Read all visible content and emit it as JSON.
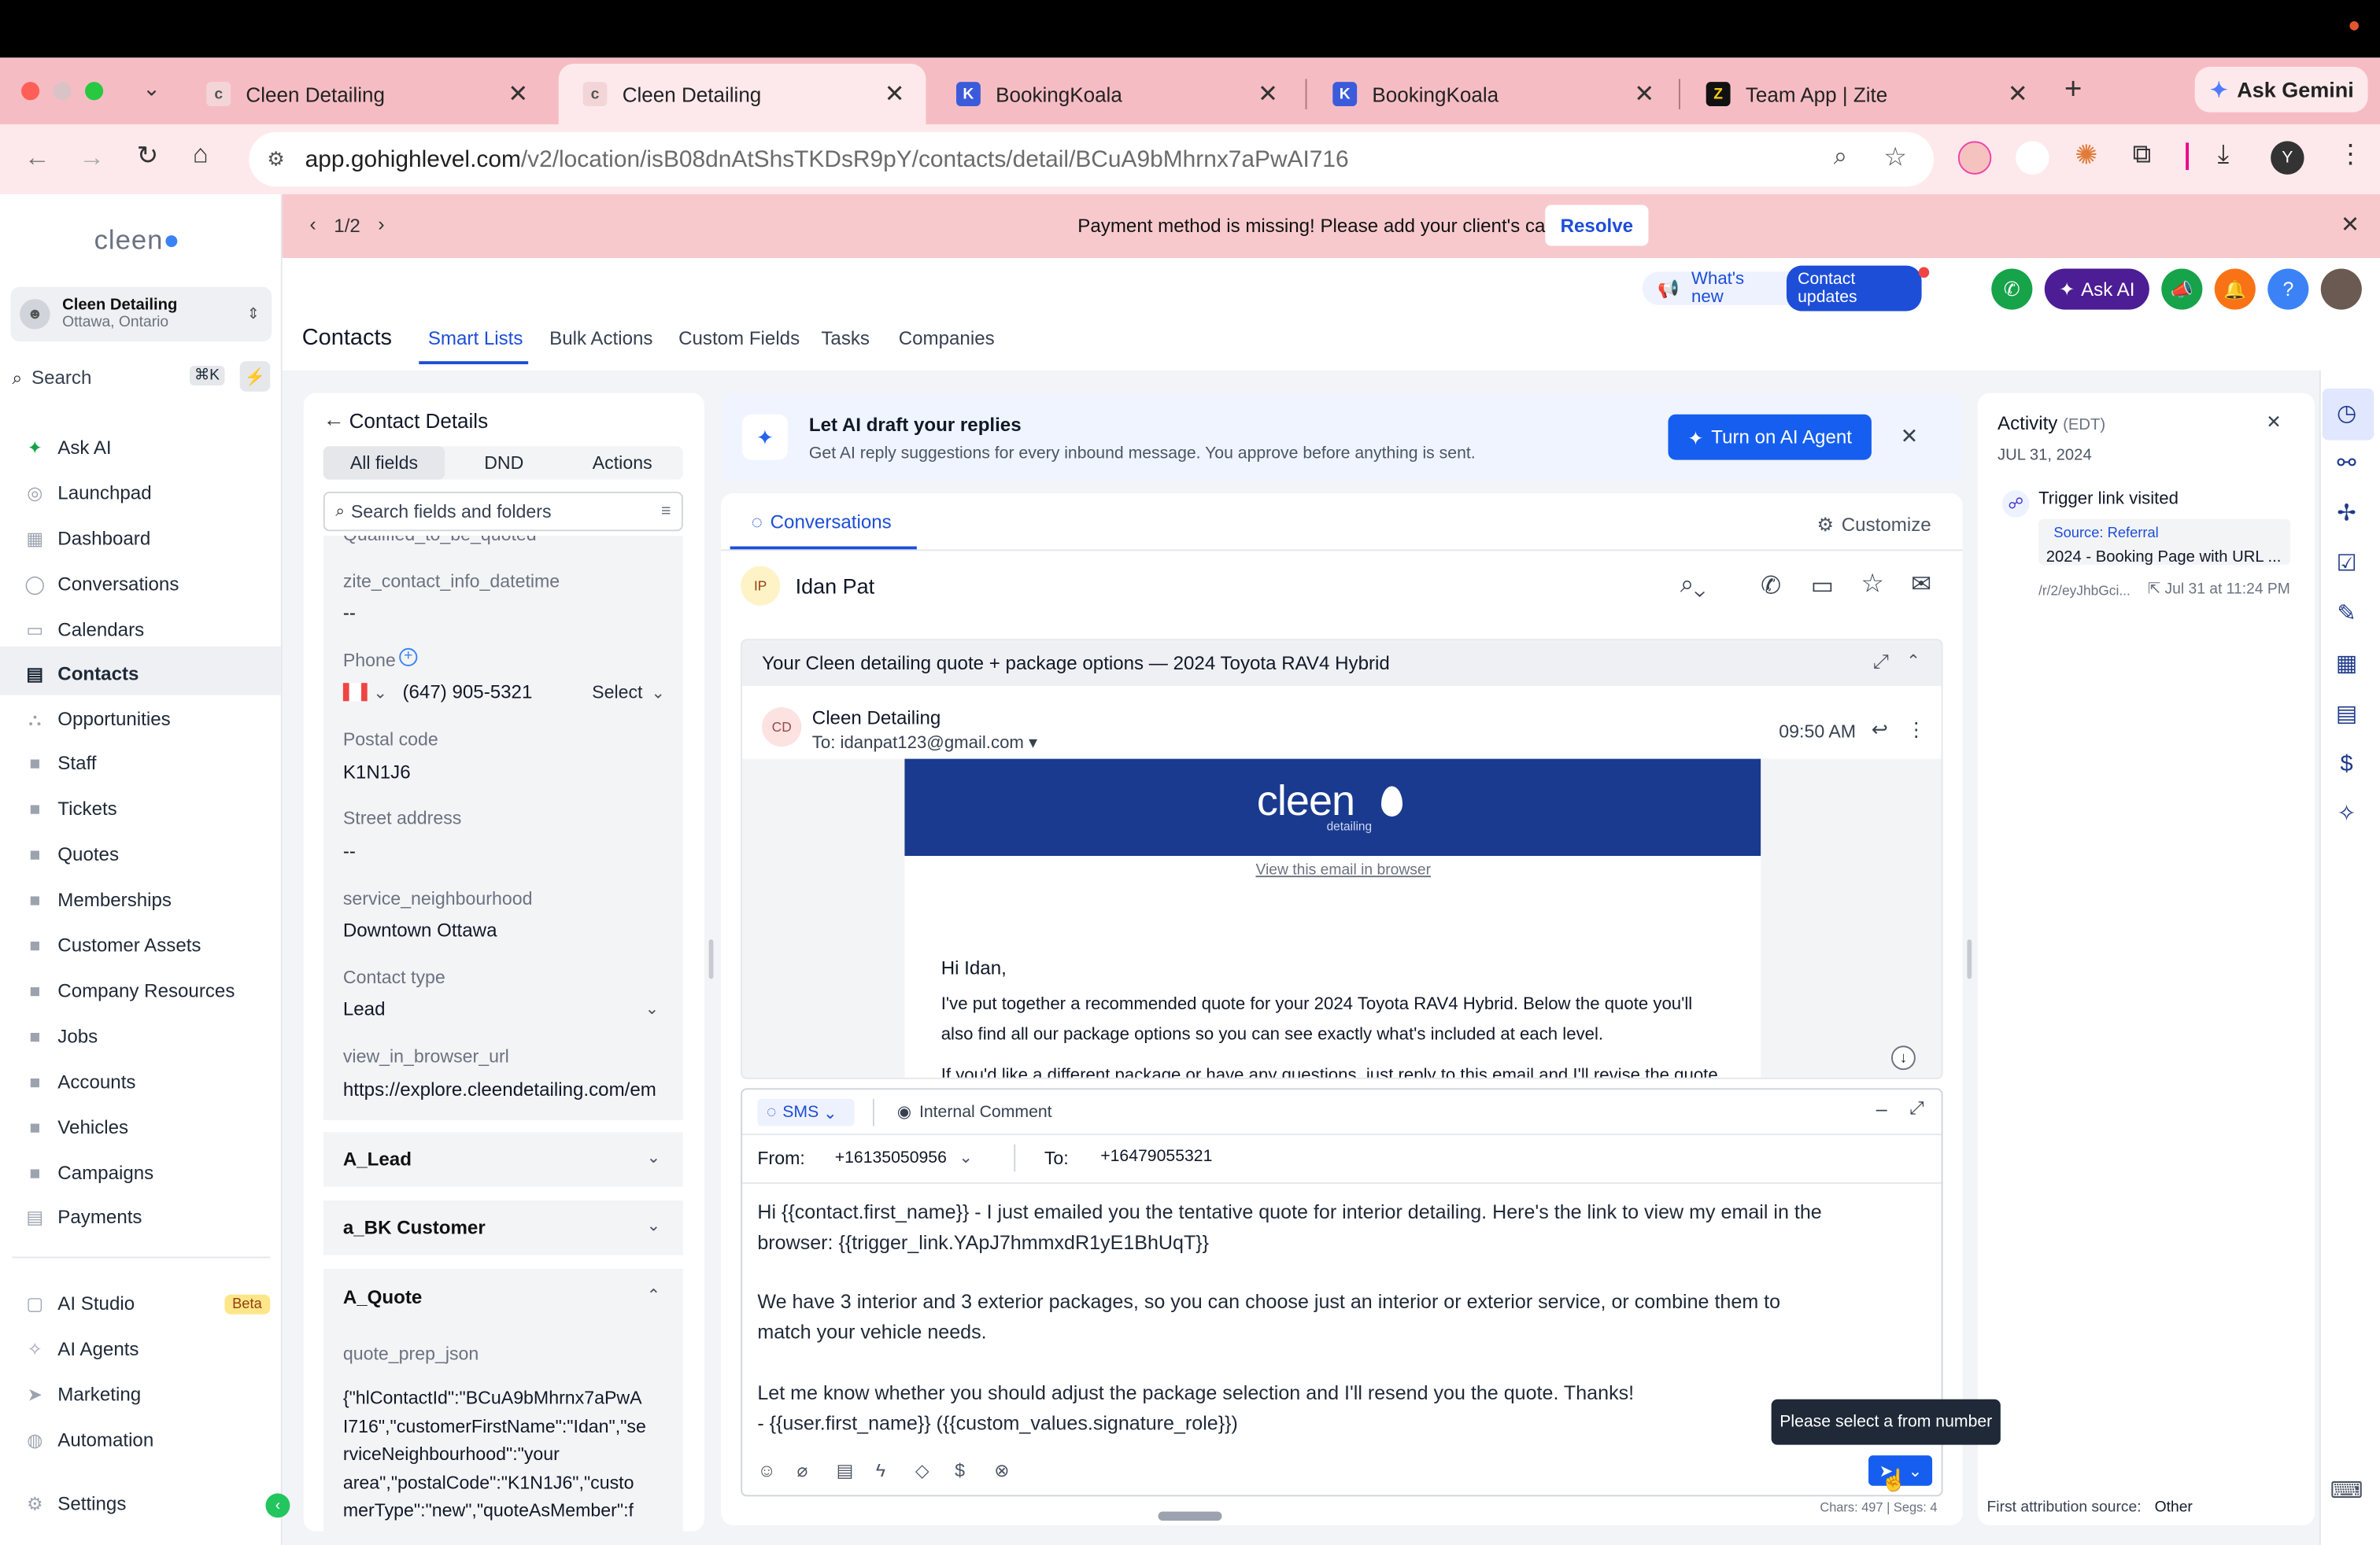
{
  "browser": {
    "tabs": [
      {
        "title": "Cleen Detailing"
      },
      {
        "title": "Cleen Detailing"
      },
      {
        "title": "BookingKoala"
      },
      {
        "title": "BookingKoala"
      },
      {
        "title": "Team App | Zite"
      }
    ],
    "ask_gemini": "Ask Gemini",
    "url_domain": "app.gohighlevel.com",
    "url_path": "/v2/location/isB08dnAtShsTKDsR9pY/contacts/detail/BCuA9bMhrnx7aPwAI716",
    "profile_initial": "Y"
  },
  "banner": {
    "pager": "1/2",
    "message": "Payment method is missing! Please add your client's card.",
    "resolve": "Resolve"
  },
  "sidebar": {
    "account_name": "Cleen Detailing",
    "account_location": "Ottawa, Ontario",
    "search_placeholder": "Search",
    "search_shortcut": "⌘K",
    "items": [
      {
        "label": "Ask AI"
      },
      {
        "label": "Launchpad"
      },
      {
        "label": "Dashboard"
      },
      {
        "label": "Conversations"
      },
      {
        "label": "Calendars"
      },
      {
        "label": "Contacts"
      },
      {
        "label": "Opportunities"
      },
      {
        "label": "Staff"
      },
      {
        "label": "Tickets"
      },
      {
        "label": "Quotes"
      },
      {
        "label": "Memberships"
      },
      {
        "label": "Customer Assets"
      },
      {
        "label": "Company Resources"
      },
      {
        "label": "Jobs"
      },
      {
        "label": "Accounts"
      },
      {
        "label": "Vehicles"
      },
      {
        "label": "Campaigns"
      },
      {
        "label": "Payments"
      }
    ],
    "bottom_items": [
      {
        "label": "AI Studio",
        "badge": "Beta"
      },
      {
        "label": "AI Agents"
      },
      {
        "label": "Marketing"
      },
      {
        "label": "Automation"
      }
    ],
    "settings": "Settings"
  },
  "header": {
    "whats_new": "What's new",
    "contact_updates": "Contact updates",
    "ask_ai": "Ask AI",
    "title": "Contacts",
    "tabs": [
      {
        "label": "Smart Lists"
      },
      {
        "label": "Bulk Actions"
      },
      {
        "label": "Custom Fields"
      },
      {
        "label": "Tasks"
      },
      {
        "label": "Companies"
      }
    ]
  },
  "contact_details": {
    "title": "Contact Details",
    "tabs": [
      {
        "label": "All fields"
      },
      {
        "label": "DND"
      },
      {
        "label": "Actions"
      }
    ],
    "search_placeholder": "Search fields and folders",
    "clipped_field": "Qualified_to_be_quoted",
    "fields": {
      "zite_label": "zite_contact_info_datetime",
      "zite_value": "--",
      "phone_label": "Phone",
      "phone_value": "(647) 905-5321",
      "phone_select": "Select",
      "postal_label": "Postal code",
      "postal_value": "K1N1J6",
      "street_label": "Street address",
      "street_value": "--",
      "neighbourhood_label": "service_neighbourhood",
      "neighbourhood_value": "Downtown Ottawa",
      "contact_type_label": "Contact type",
      "contact_type_value": "Lead",
      "view_url_label": "view_in_browser_url",
      "view_url_value": "https://explore.cleendetailing.com/em"
    },
    "sections": [
      {
        "label": "A_Lead"
      },
      {
        "label": "a_BK Customer"
      },
      {
        "label": "A_Quote"
      }
    ],
    "quote_label": "quote_prep_json",
    "quote_lines": [
      "{\"hlContactId\":\"BCuA9bMhrnx7aPwA",
      "I716\",\"customerFirstName\":\"Idan\",\"se",
      "rviceNeighbourhood\":\"your",
      "area\",\"postalCode\":\"K1N1J6\",\"custo",
      "merType\":\"new\",\"quoteAsMember\":f"
    ]
  },
  "ai_banner": {
    "title": "Let AI draft your replies",
    "subtitle": "Get AI reply suggestions for every inbound message. You approve before anything is sent.",
    "button": "Turn on AI Agent"
  },
  "conversation": {
    "tab": "Conversations",
    "customize": "Customize",
    "contact_initials": "IP",
    "contact_name": "Idan Pat",
    "email_subject": "Your Cleen detailing quote + package options — 2024 Toyota RAV4 Hybrid",
    "sender_initials": "CD",
    "sender": "Cleen Detailing",
    "to": "To: idanpat123@gmail.com",
    "time": "09:50 AM",
    "logo_text": "cleen",
    "logo_sub": "detailing",
    "view_in_browser": "View this email in browser",
    "greeting": "Hi Idan,",
    "body_1": "I've put together a recommended quote for your 2024 Toyota RAV4 Hybrid. Below the quote you'll",
    "body_2": "also find all our package options so you can see exactly what's included at each level.",
    "body_3": "If you'd like a different package or have any questions, just reply to this email and I'll revise the quote."
  },
  "composer": {
    "channel": "SMS",
    "internal_comment": "Internal Comment",
    "from_label": "From:",
    "from_value": "+16135050956",
    "to_label": "To:",
    "to_value": "+16479055321",
    "message_lines": [
      "Hi {{contact.first_name}} - I just emailed you the tentative quote for interior detailing. Here's the link to view my email in the",
      "browser: {{trigger_link.YApJ7hmmxdR1yE1BhUqT}}",
      "",
      "We have 3 interior and 3 exterior packages, so you can choose just an interior or exterior service, or combine them to",
      "match your vehicle needs.",
      "",
      "Let me know whether you should adjust the package selection and I'll resend you the quote. Thanks!",
      "- {{user.first_name}} ({{custom_values.signature_role}})"
    ],
    "tooltip": "Please select a from number",
    "chars": "Chars: 497 | Segs: 4"
  },
  "activity": {
    "title": "Activity",
    "tz": "(EDT)",
    "date": "JUL 31, 2024",
    "event_title": "Trigger link visited",
    "source": "Source: Referral",
    "page": "2024 - Booking Page with URL ...",
    "link": "/r/2/eyJhbGci...",
    "event_time": "Jul 31 at 11:24 PM",
    "attribution_label": "First attribution source:",
    "attribution_value": "Other"
  },
  "colors": {
    "primary": "#155eef",
    "tab_strip": "#f6bcc4",
    "banner": "#f7c9cd",
    "email_header": "#1a3a8f",
    "ask_ai": "#4c1d95"
  }
}
